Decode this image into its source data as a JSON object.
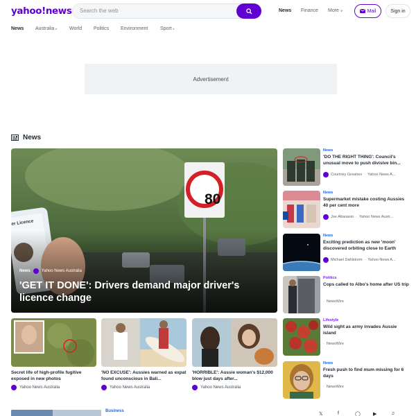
{
  "header": {
    "logo": "yahoo!news",
    "search_placeholder": "Search the web",
    "nav": [
      "News",
      "Finance",
      "More"
    ],
    "mail_label": "Mail",
    "signin_label": "Sign in"
  },
  "subnav": [
    "News",
    "Australia",
    "World",
    "Politics",
    "Environment",
    "Sport"
  ],
  "ad_label": "Advertisement",
  "section_title": "News",
  "hero": {
    "tag": "News",
    "source": "Yahoo News Australia",
    "title": "'GET IT DONE': Drivers demand major driver's licence change",
    "sign_number": "80",
    "phone_text": "er Licence"
  },
  "cards": [
    {
      "title": "Secret life of high-profile fugitive exposed in new photos",
      "source": "Yahoo News Australia"
    },
    {
      "title": "'NO EXCUSE': Aussies warned as expat found unconscious in Bali...",
      "source": "Yahoo News Australia"
    },
    {
      "title": "'HORRIBLE': Aussie woman's $12,000 blow just days after...",
      "source": "Yahoo News Australia"
    }
  ],
  "side_items": [
    {
      "category": "News",
      "title": "'DO THE RIGHT THING': Council's unusual move to push divisive bin...",
      "author": "Courtney Greatrex",
      "source": "Yahoo News A..."
    },
    {
      "category": "News",
      "title": "Supermarket mistake costing Aussies 40 per cent more",
      "author": "Joe Attanasio",
      "source": "Yahoo News Austr..."
    },
    {
      "category": "News",
      "title": "Exciting prediction as new 'moon' discovered orbiting close to Earth",
      "author": "Michael Dahlstrom",
      "source": "Yahoo News A..."
    },
    {
      "category": "Politics",
      "title": "Cops called to Albo's home after US trip",
      "author": "",
      "source": "NewsWire"
    },
    {
      "category": "Lifestyle",
      "title": "Wild sight as army invades Aussie island",
      "author": "",
      "source": "NewsWire"
    },
    {
      "category": "News",
      "title": "Fresh push to find mum missing for 6 days",
      "author": "",
      "source": "NewsWire"
    }
  ],
  "bottom_category": "Business",
  "colors": {
    "brand": "#6001d2",
    "link": "#0f69ff",
    "lifestyle": "#7e1fff"
  }
}
